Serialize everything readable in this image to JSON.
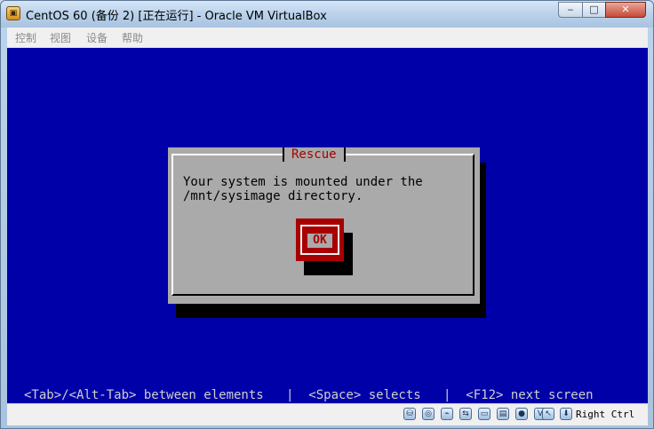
{
  "window": {
    "title": "CentOS 60 (备份 2) [正在运行] - Oracle VM VirtualBox",
    "controls": {
      "minimize": "‒",
      "maximize": "□",
      "close": "✕"
    }
  },
  "menu": {
    "items": [
      "控制",
      "视图",
      "设备",
      "帮助"
    ]
  },
  "dialog": {
    "title": "Rescue",
    "message_line1": "Your system is mounted under the",
    "message_line2": "/mnt/sysimage directory.",
    "ok_label": "OK"
  },
  "help_line": "<Tab>/<Alt-Tab> between elements   |  <Space> selects   |  <F12> next screen",
  "statusbar": {
    "icons": [
      "hard-disk-icon",
      "optical-drive-icon",
      "usb-icon",
      "shared-folders-icon",
      "display-icon",
      "network-icon",
      "video-capture-icon",
      "virtualization-icon",
      "mouse-integration-icon",
      "keyboard-capture-icon"
    ],
    "host_key": "Right Ctrl"
  },
  "colors": {
    "guest_background": "#0000a8",
    "dialog_gray": "#aaaaaa",
    "accent_red": "#a80000"
  }
}
